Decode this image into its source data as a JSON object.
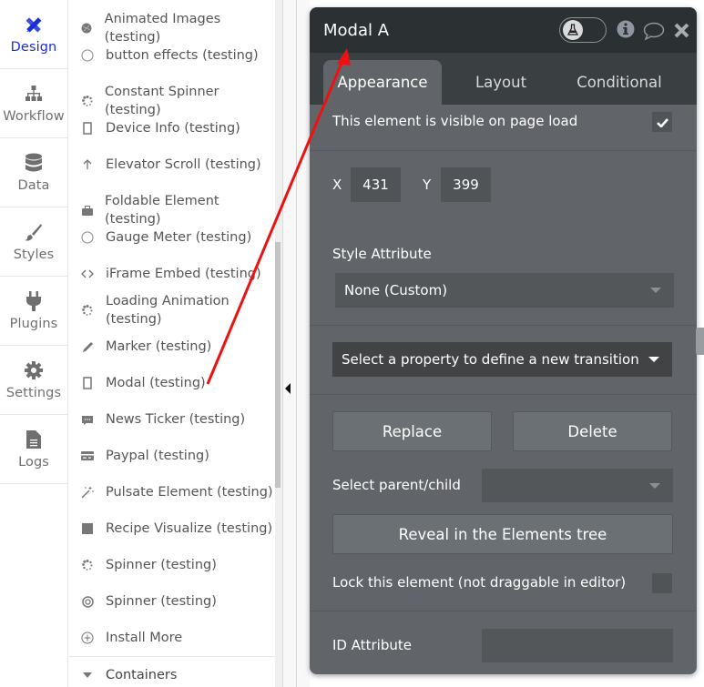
{
  "left_nav": {
    "items": [
      {
        "label": "Design",
        "icon": "design-icon",
        "active": true
      },
      {
        "label": "Workflow",
        "icon": "workflow-icon",
        "active": false
      },
      {
        "label": "Data",
        "icon": "database-icon",
        "active": false
      },
      {
        "label": "Styles",
        "icon": "brush-icon",
        "active": false
      },
      {
        "label": "Plugins",
        "icon": "plug-icon",
        "active": false
      },
      {
        "label": "Settings",
        "icon": "gear-icon",
        "active": false
      },
      {
        "label": "Logs",
        "icon": "document-icon",
        "active": false
      }
    ]
  },
  "element_list": {
    "items": [
      {
        "label": "Animated Images (testing)",
        "icon": "animated-image-icon"
      },
      {
        "label": "button effects (testing)",
        "icon": "circle-icon"
      },
      {
        "label": "Constant Spinner (testing)",
        "icon": "spinner-icon"
      },
      {
        "label": "Device Info (testing)",
        "icon": "mobile-icon"
      },
      {
        "label": "Elevator Scroll (testing)",
        "icon": "arrow-up-icon"
      },
      {
        "label": "Foldable Element (testing)",
        "icon": "briefcase-icon"
      },
      {
        "label": "Gauge Meter (testing)",
        "icon": "circle-icon"
      },
      {
        "label": "iFrame Embed (testing)",
        "icon": "code-icon"
      },
      {
        "label": "Loading Animation (testing)",
        "icon": "spinner-icon"
      },
      {
        "label": "Marker (testing)",
        "icon": "pencil-icon"
      },
      {
        "label": "Modal (testing)",
        "icon": "mobile-icon"
      },
      {
        "label": "News Ticker (testing)",
        "icon": "comment-icon"
      },
      {
        "label": "Paypal (testing)",
        "icon": "credit-card-icon"
      },
      {
        "label": "Pulsate Element (testing)",
        "icon": "magic-wand-icon"
      },
      {
        "label": "Recipe Visualize (testing)",
        "icon": "square-icon"
      },
      {
        "label": "Spinner (testing)",
        "icon": "spinner-icon"
      },
      {
        "label": "Spinner (testing)",
        "icon": "life-ring-icon"
      },
      {
        "label": "Install More",
        "icon": "plus-circle-icon"
      }
    ],
    "section": {
      "label": "Containers",
      "icon": "caret-down-icon"
    }
  },
  "panel": {
    "title": "Modal A",
    "toggle_icon": "flask-icon",
    "header_icons": [
      "info-icon",
      "comment-icon",
      "close-icon"
    ],
    "tabs": [
      {
        "label": "Appearance",
        "active": true
      },
      {
        "label": "Layout",
        "active": false
      },
      {
        "label": "Conditional",
        "active": false
      }
    ],
    "visible_on_load": {
      "label": "This element is visible on page load",
      "checked": true
    },
    "x_label": "X",
    "x_value": "431",
    "y_label": "Y",
    "y_value": "399",
    "style_attribute_label": "Style Attribute",
    "style_attribute_value": "None (Custom)",
    "transition_placeholder": "Select a property to define a new transition",
    "replace_label": "Replace",
    "delete_label": "Delete",
    "parent_child_label": "Select parent/child",
    "parent_child_value": "",
    "reveal_label": "Reveal in the Elements tree",
    "lock": {
      "label": "Lock this element (not draggable in editor)",
      "checked": false
    },
    "id_attribute_label": "ID Attribute",
    "id_attribute_value": ""
  },
  "annotation": {
    "color": "#ee1111"
  }
}
